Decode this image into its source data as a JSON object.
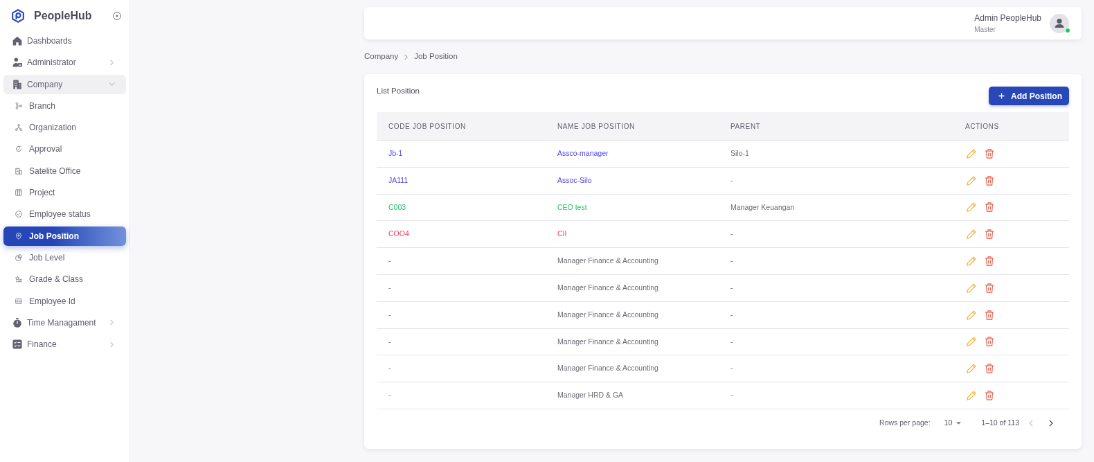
{
  "sidebar": {
    "brand": "PeopleHub",
    "items": [
      {
        "label": "Dashboards",
        "kind": "link",
        "selected": false
      },
      {
        "label": "Administrator",
        "kind": "group",
        "selected": false,
        "expanded": false
      },
      {
        "label": "Company",
        "kind": "group",
        "selected": true,
        "expanded": true,
        "children": [
          {
            "label": "Branch",
            "selected": false
          },
          {
            "label": "Organization",
            "selected": false
          },
          {
            "label": "Approval",
            "selected": false
          },
          {
            "label": "Satelite Office",
            "selected": false
          },
          {
            "label": "Project",
            "selected": false
          },
          {
            "label": "Employee status",
            "selected": false
          },
          {
            "label": "Job Position",
            "selected": true
          },
          {
            "label": "Job Level",
            "selected": false
          },
          {
            "label": "Grade & Class",
            "selected": false
          },
          {
            "label": "Employee Id",
            "selected": false
          }
        ]
      },
      {
        "label": "Time Managament",
        "kind": "group",
        "selected": false,
        "expanded": false
      },
      {
        "label": "Finance",
        "kind": "group",
        "selected": false,
        "expanded": false
      }
    ]
  },
  "header": {
    "user_name": "Admin PeopleHub",
    "user_role": "Master",
    "online": true
  },
  "breadcrumb": [
    "Company",
    "Job Position"
  ],
  "card": {
    "title": "List Position",
    "add_button": "Add Position"
  },
  "table": {
    "columns": [
      "CODE JOB POSITION",
      "NAME JOB POSITION",
      "PARENT",
      "ACTIONS"
    ],
    "rows": [
      {
        "code": "Jb-1",
        "name": "Assco-manager",
        "parent": "Silo-1",
        "color": "#4f46e5"
      },
      {
        "code": "JA111",
        "name": "Assoc-Silo",
        "parent": "-",
        "color": "#4f46e5"
      },
      {
        "code": "C003",
        "name": "CEO test",
        "parent": "Manager Keuangan",
        "color": "#22c55e"
      },
      {
        "code": "COO4",
        "name": "CII",
        "parent": "-",
        "color": "#f43f5e"
      },
      {
        "code": "-",
        "name": "Manager Finance & Accounting",
        "parent": "-"
      },
      {
        "code": "-",
        "name": "Manager Finance & Accounting",
        "parent": "-"
      },
      {
        "code": "-",
        "name": "Manager Finance & Accounting",
        "parent": "-"
      },
      {
        "code": "-",
        "name": "Manager Finance & Accounting",
        "parent": "-"
      },
      {
        "code": "-",
        "name": "Manager Finance & Accounting",
        "parent": "-"
      },
      {
        "code": "-",
        "name": "Manager HRD & GA",
        "parent": "-"
      }
    ]
  },
  "pagination": {
    "rows_per_page_label": "Rows per page:",
    "rows_per_page": "10",
    "range": "1–10 of 113",
    "prev": {
      "disabled": true
    },
    "next": {
      "disabled": false
    }
  }
}
